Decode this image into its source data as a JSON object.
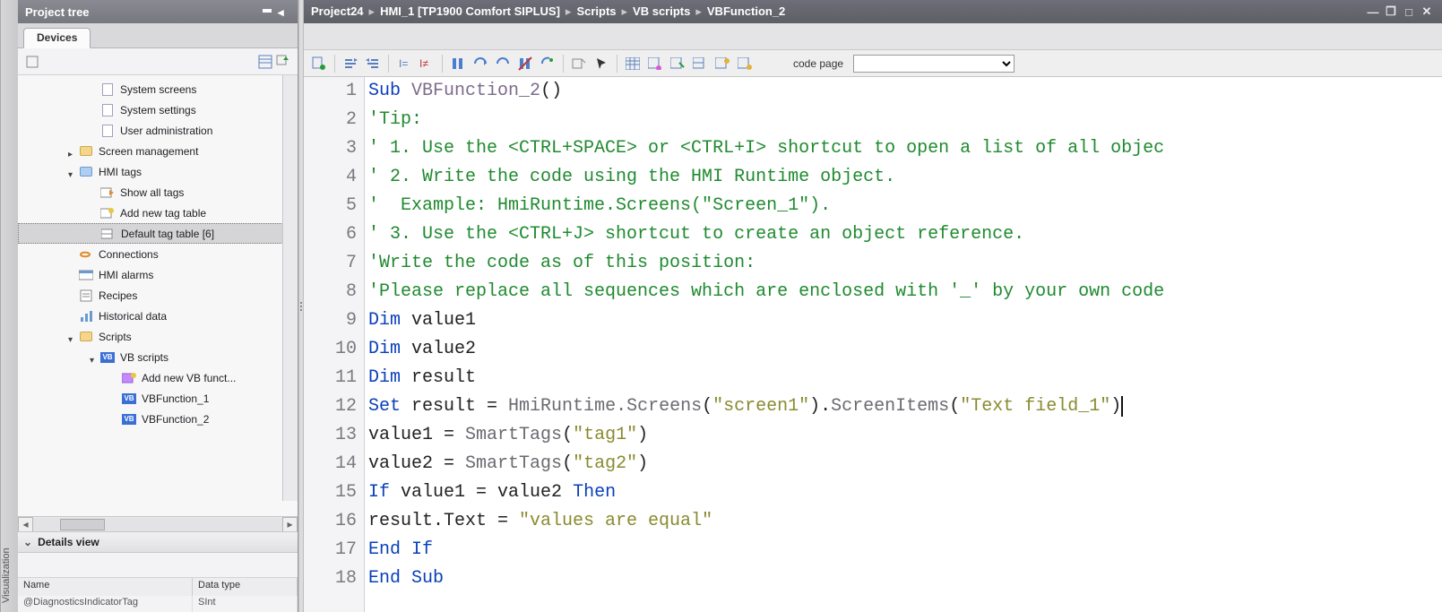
{
  "vstrip_label": "Visualization",
  "project_tree": {
    "title": "Project tree",
    "tabs": {
      "devices": "Devices"
    },
    "items": [
      {
        "label": "System screens",
        "indent": 80,
        "icon": "page"
      },
      {
        "label": "System settings",
        "indent": 80,
        "icon": "page"
      },
      {
        "label": "User administration",
        "indent": 80,
        "icon": "page"
      },
      {
        "label": "Screen management",
        "indent": 56,
        "icon": "folder",
        "arrow": "right"
      },
      {
        "label": "HMI tags",
        "indent": 56,
        "icon": "folder-blue",
        "arrow": "down"
      },
      {
        "label": "Show all tags",
        "indent": 80,
        "icon": "tag"
      },
      {
        "label": "Add new tag table",
        "indent": 80,
        "icon": "tag-add"
      },
      {
        "label": "Default tag table [6]",
        "indent": 80,
        "icon": "tag-table",
        "selected": true
      },
      {
        "label": "Connections",
        "indent": 56,
        "icon": "conn"
      },
      {
        "label": "HMI alarms",
        "indent": 56,
        "icon": "alarm"
      },
      {
        "label": "Recipes",
        "indent": 56,
        "icon": "recipe"
      },
      {
        "label": "Historical data",
        "indent": 56,
        "icon": "hist"
      },
      {
        "label": "Scripts",
        "indent": 56,
        "icon": "folder",
        "arrow": "down"
      },
      {
        "label": "VB scripts",
        "indent": 80,
        "icon": "vb-folder",
        "arrow": "down"
      },
      {
        "label": "Add new VB funct...",
        "indent": 104,
        "icon": "vb-add"
      },
      {
        "label": "VBFunction_1",
        "indent": 104,
        "icon": "vb"
      },
      {
        "label": "VBFunction_2",
        "indent": 104,
        "icon": "vb"
      }
    ]
  },
  "details": {
    "title": "Details view",
    "columns": [
      "Name",
      "Data type"
    ],
    "row": [
      "@DiagnosticsIndicatorTag",
      "SInt"
    ]
  },
  "breadcrumb": [
    "Project24",
    "HMI_1 [TP1900 Comfort SIPLUS]",
    "Scripts",
    "VB scripts",
    "VBFunction_2"
  ],
  "toolbar": {
    "code_page_label": "code page"
  },
  "code": {
    "lines": [
      {
        "n": 1,
        "html": "<span class='kw'>Sub</span> <span class='fn'>VBFunction_2</span>()"
      },
      {
        "n": 2,
        "html": "<span class='cm'>'Tip:</span>"
      },
      {
        "n": 3,
        "html": "<span class='cm'>' 1. Use the &lt;CTRL+SPACE&gt; or &lt;CTRL+I&gt; shortcut to open a list of all objec</span>"
      },
      {
        "n": 4,
        "html": "<span class='cm'>' 2. Write the code using the HMI Runtime object.</span>"
      },
      {
        "n": 5,
        "html": "<span class='cm'>'  Example: HmiRuntime.Screens(\"Screen_1\").</span>"
      },
      {
        "n": 6,
        "html": "<span class='cm'>' 3. Use the &lt;CTRL+J&gt; shortcut to create an object reference.</span>"
      },
      {
        "n": 7,
        "html": "<span class='cm'>'Write the code as of this position:</span>"
      },
      {
        "n": 8,
        "html": "<span class='cm'>'Please replace all sequences which are enclosed with '_' by your own code</span>"
      },
      {
        "n": 9,
        "html": "<span class='kw'>Dim</span> value1"
      },
      {
        "n": 10,
        "html": "<span class='kw'>Dim</span> value2"
      },
      {
        "n": 11,
        "html": "<span class='kw'>Dim</span> result"
      },
      {
        "n": 12,
        "html": "<span class='kw'>Set</span> result = <span class='id'>HmiRuntime.Screens</span>(<span class='str'>\"screen1\"</span>).<span class='id'>ScreenItems</span>(<span class='str'>\"Text field_1\"</span>)<span class='caret'></span>"
      },
      {
        "n": 13,
        "html": "value1 = <span class='id'>SmartTags</span>(<span class='str'>\"tag1\"</span>)"
      },
      {
        "n": 14,
        "html": "value2 = <span class='id'>SmartTags</span>(<span class='str'>\"tag2\"</span>)"
      },
      {
        "n": 15,
        "html": "<span class='kw'>If</span> value1 = value2 <span class='kw'>Then</span>"
      },
      {
        "n": 16,
        "html": "result.Text = <span class='str'>\"values are equal\"</span>"
      },
      {
        "n": 17,
        "html": "<span class='kw'>End If</span>"
      },
      {
        "n": 18,
        "html": "<span class='kw'>End Sub</span>"
      }
    ]
  }
}
